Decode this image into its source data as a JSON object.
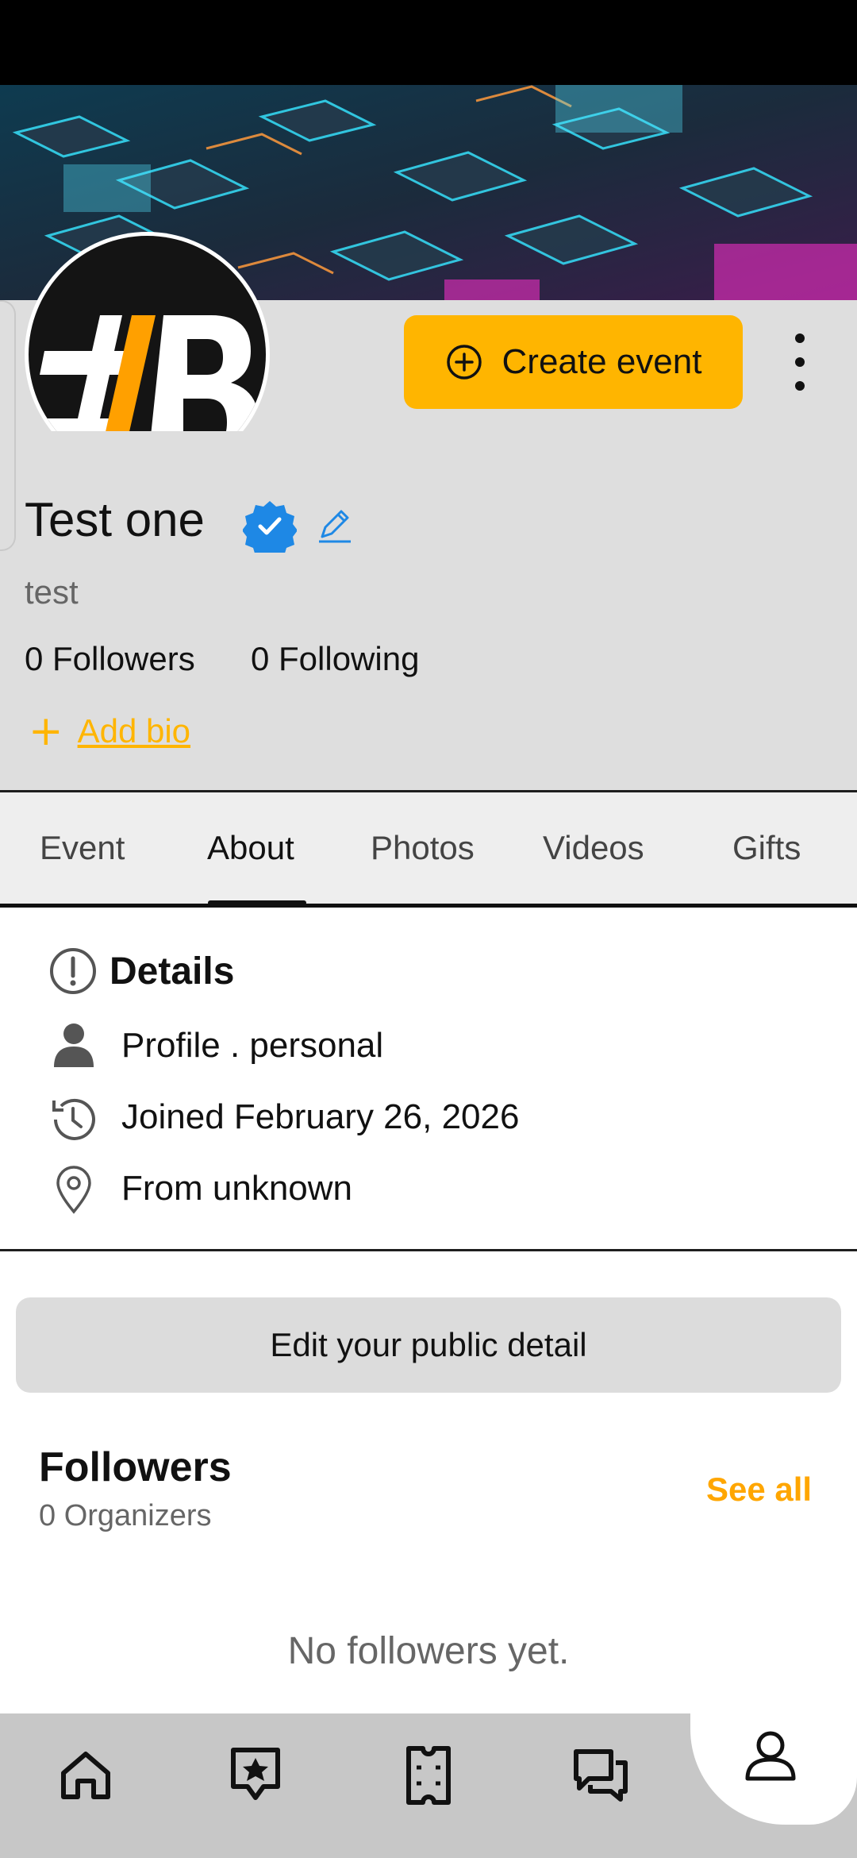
{
  "profile": {
    "create_event_label": "Create event",
    "name": "Test one",
    "handle": "test",
    "followers_count_label": "0 Followers",
    "following_count_label": "0 Following",
    "add_bio_label": "Add bio"
  },
  "tabs": [
    {
      "label": "Event"
    },
    {
      "label": "About"
    },
    {
      "label": "Photos"
    },
    {
      "label": "Videos"
    },
    {
      "label": "Gifts"
    }
  ],
  "active_tab": "About",
  "details": {
    "title": "Details",
    "profile_label": "Profile .  personal",
    "joined_label": "Joined  February 26, 2026",
    "from_label": "From unknown"
  },
  "edit_public_label": "Edit your public detail",
  "followers_section": {
    "title": "Followers",
    "subtitle": "0 Organizers",
    "see_all_label": "See all",
    "empty_text": "No followers yet."
  },
  "bottom_nav": [
    {
      "icon": "home-icon"
    },
    {
      "icon": "star-badge-icon"
    },
    {
      "icon": "ticket-icon"
    },
    {
      "icon": "chat-icon"
    },
    {
      "icon": "user-icon",
      "active": true
    }
  ],
  "colors": {
    "accent": "#ffb500",
    "verified": "#1e88e5",
    "nav_bg": "#c7c7c7"
  }
}
